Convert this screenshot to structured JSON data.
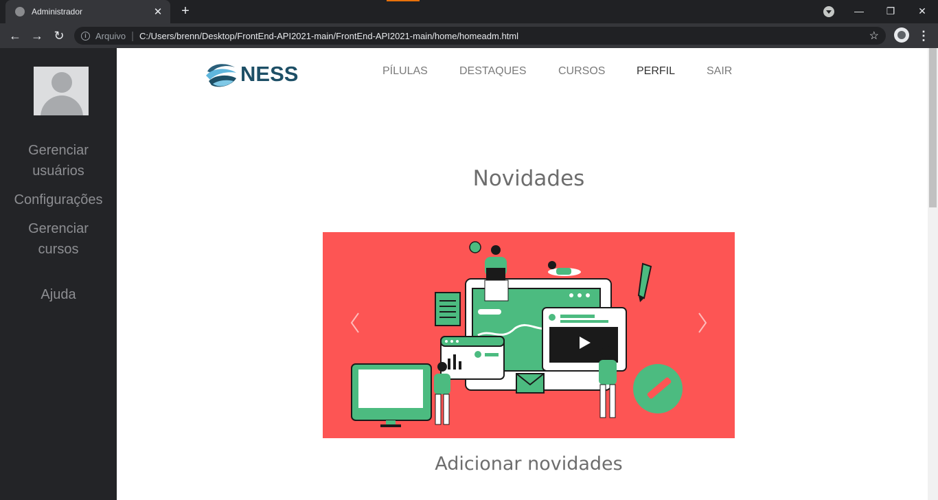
{
  "browser": {
    "tab_title": "Administrador",
    "scheme_label": "Arquivo",
    "url": "C:/Users/brenn/Desktop/FrontEnd-API2021-main/FrontEnd-API2021-main/home/homeadm.html"
  },
  "logo": {
    "text": "NESS"
  },
  "nav": {
    "items": [
      {
        "label": "PÍLULAS"
      },
      {
        "label": "DESTAQUES"
      },
      {
        "label": "CURSOS"
      },
      {
        "label": "PERFIL"
      },
      {
        "label": "SAIR"
      }
    ]
  },
  "sidebar": {
    "items": [
      {
        "line1": "Gerenciar",
        "line2": "usuários"
      },
      {
        "line1": "Configurações"
      },
      {
        "line1": "Gerenciar",
        "line2": "cursos"
      },
      {
        "line1": "Ajuda"
      }
    ]
  },
  "main": {
    "section_title": "Novidades",
    "add_title": "Adicionar novidades"
  },
  "colors": {
    "carousel_bg": "#fd5554",
    "illustration_green": "#4cbb80",
    "logo_blue": "#1d4f66"
  }
}
